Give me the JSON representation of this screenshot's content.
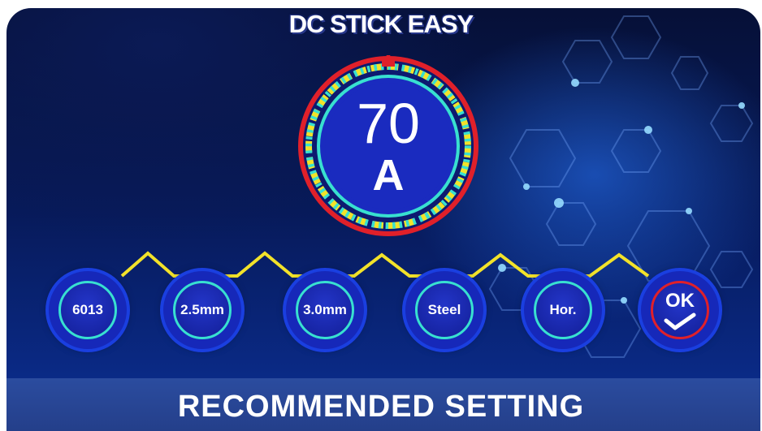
{
  "header": {
    "title": "DC STICK EASY"
  },
  "dial": {
    "value": "70",
    "unit": "A"
  },
  "settings": {
    "steps": [
      {
        "label": "6013"
      },
      {
        "label": "2.5mm"
      },
      {
        "label": "3.0mm"
      },
      {
        "label": "Steel"
      },
      {
        "label": "Hor."
      }
    ],
    "ok_label": "OK"
  },
  "footer": {
    "label": "RECOMMENDED SETTING"
  },
  "colors": {
    "accent_red": "#e0202a",
    "accent_cyan": "#38e0d0",
    "zigzag_yellow": "#f2e22a",
    "circle_blue": "#1628b9"
  },
  "icons": [
    "pointer-arrow-icon",
    "check-icon"
  ]
}
